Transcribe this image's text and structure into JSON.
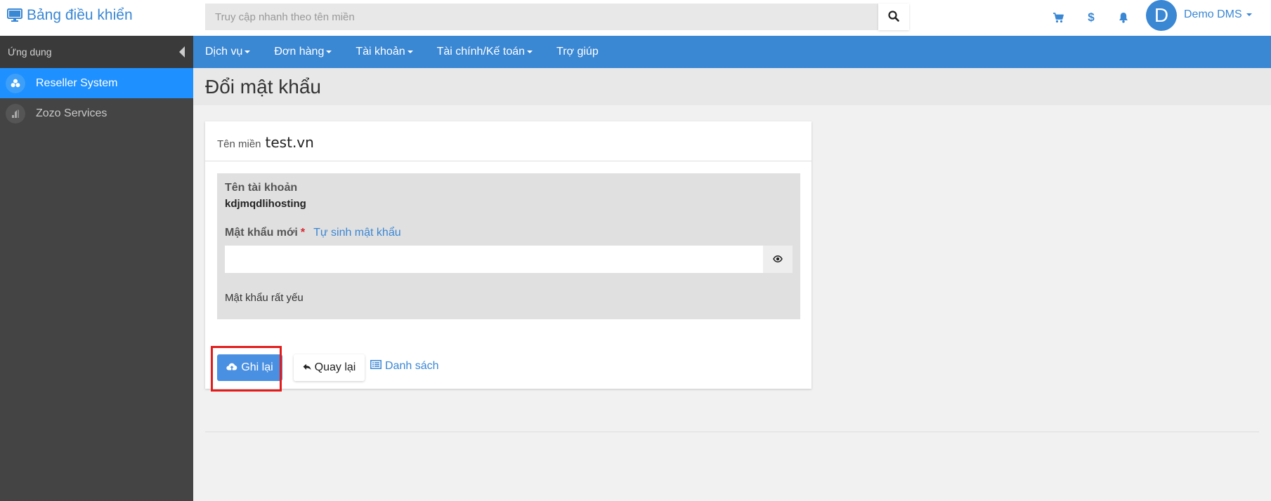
{
  "header": {
    "brand_title": "Bảng điều khiển",
    "search_placeholder": "Truy cập nhanh theo tên miền",
    "user_initial": "D",
    "user_name": "Demo DMS"
  },
  "sidebar": {
    "title": "Ứng dụng",
    "items": [
      {
        "label": "Reseller System",
        "active": true
      },
      {
        "label": "Zozo Services",
        "active": false
      }
    ]
  },
  "nav": {
    "items": [
      {
        "label": "Dịch vụ",
        "dropdown": true
      },
      {
        "label": "Đơn hàng",
        "dropdown": true
      },
      {
        "label": "Tài khoản",
        "dropdown": true
      },
      {
        "label": "Tài chính/Kế toán",
        "dropdown": true
      },
      {
        "label": "Trợ giúp",
        "dropdown": false
      }
    ]
  },
  "page": {
    "title": "Đổi mật khẩu",
    "domain_label": "Tên miền",
    "domain_value": "test.vn"
  },
  "form": {
    "account_label": "Tên tài khoản",
    "account_value": "kdjmqdlihosting",
    "new_password_label": "Mật khẩu mới",
    "required_mark": "*",
    "generate_link": "Tự sinh mật khẩu",
    "password_value": "",
    "strength_text": "Mật khẩu rất yếu"
  },
  "actions": {
    "save_label": "Ghi lại",
    "back_label": "Quay lại",
    "list_label": "Danh sách"
  },
  "colors": {
    "primary": "#3a87d4",
    "sidebar_bg": "#444444",
    "active_item": "#1e90ff",
    "highlight": "#e31b1b"
  }
}
